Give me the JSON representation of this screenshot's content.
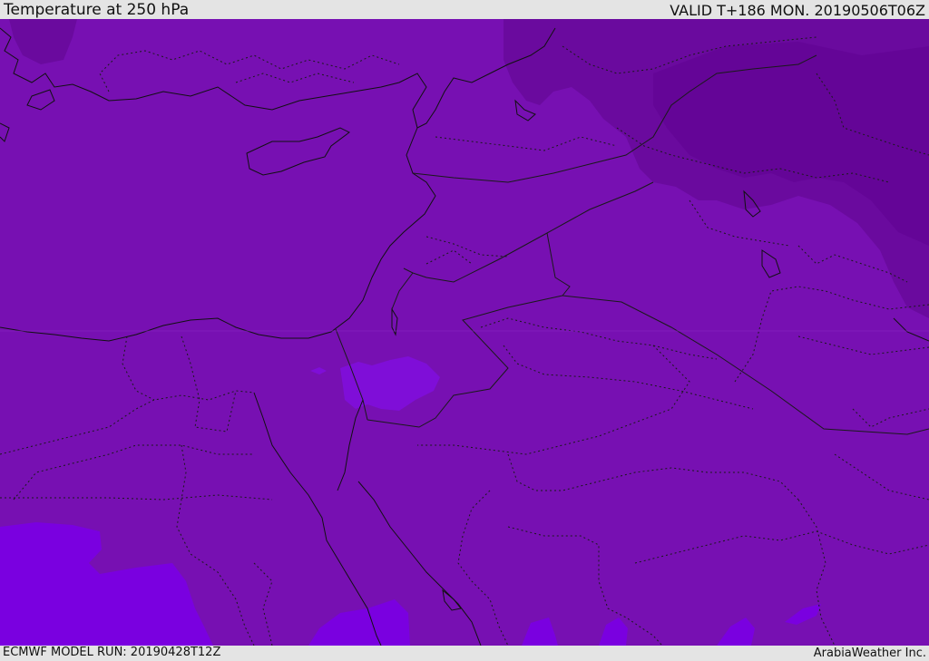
{
  "header": {
    "title": "Temperature at 250 hPa",
    "valid_time": "VALID T+186 MON. 20190506T06Z"
  },
  "footer": {
    "model_run": "ECMWF MODEL RUN: 20190428T12Z",
    "credit": "ArabiaWeather Inc."
  },
  "colors": {
    "base_field": "#7710b2",
    "cold_field": "#6a0a9e",
    "warm_field": "#7f0ed8",
    "warmest_field": "#7a00e0",
    "coastlines": "#111111",
    "borders": "#1a1a1a"
  }
}
